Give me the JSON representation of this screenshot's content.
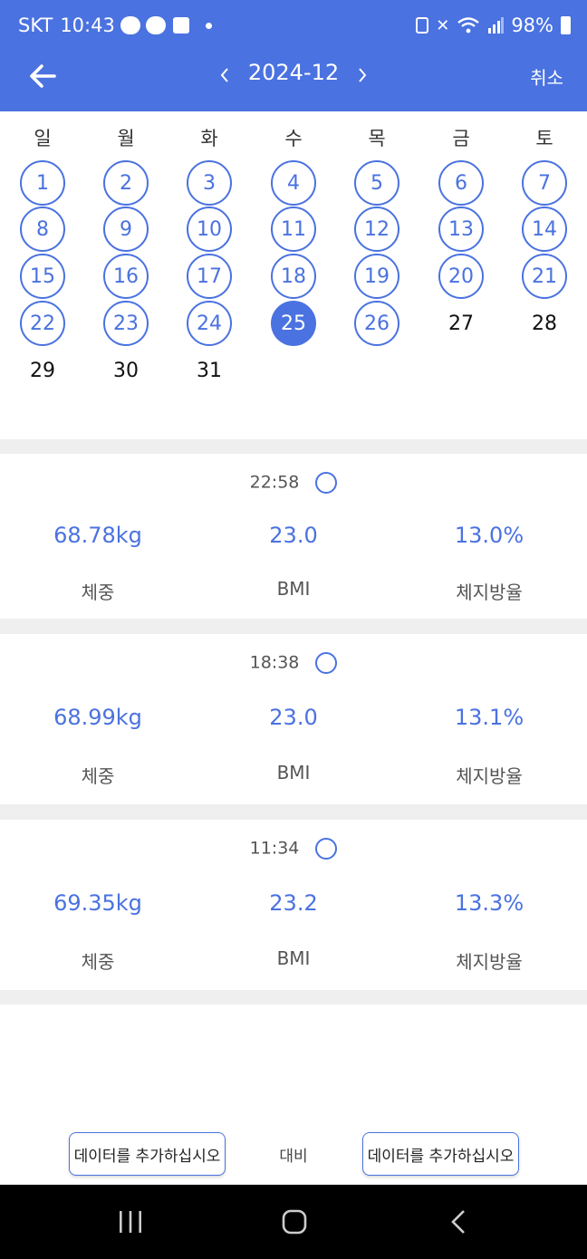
{
  "status_bar": {
    "carrier": "SKT",
    "time": "10:43",
    "battery": "98%"
  },
  "header": {
    "month": "2024-12",
    "cancel": "취소",
    "back_icon": "arrow-left-icon",
    "prev_icon": "chevron-left-icon",
    "next_icon": "chevron-right-icon"
  },
  "calendar": {
    "weekdays": [
      "일",
      "월",
      "화",
      "수",
      "목",
      "금",
      "토"
    ],
    "days": [
      {
        "d": "1",
        "s": "mark"
      },
      {
        "d": "2",
        "s": "mark"
      },
      {
        "d": "3",
        "s": "mark"
      },
      {
        "d": "4",
        "s": "mark"
      },
      {
        "d": "5",
        "s": "mark"
      },
      {
        "d": "6",
        "s": "mark"
      },
      {
        "d": "7",
        "s": "mark"
      },
      {
        "d": "8",
        "s": "mark"
      },
      {
        "d": "9",
        "s": "mark"
      },
      {
        "d": "10",
        "s": "mark"
      },
      {
        "d": "11",
        "s": "mark"
      },
      {
        "d": "12",
        "s": "mark"
      },
      {
        "d": "13",
        "s": "mark"
      },
      {
        "d": "14",
        "s": "mark"
      },
      {
        "d": "15",
        "s": "mark"
      },
      {
        "d": "16",
        "s": "mark"
      },
      {
        "d": "17",
        "s": "mark"
      },
      {
        "d": "18",
        "s": "mark"
      },
      {
        "d": "19",
        "s": "mark"
      },
      {
        "d": "20",
        "s": "mark"
      },
      {
        "d": "21",
        "s": "mark"
      },
      {
        "d": "22",
        "s": "mark"
      },
      {
        "d": "23",
        "s": "mark"
      },
      {
        "d": "24",
        "s": "mark"
      },
      {
        "d": "25",
        "s": "sel"
      },
      {
        "d": "26",
        "s": "mark"
      },
      {
        "d": "27",
        "s": "plain"
      },
      {
        "d": "28",
        "s": "plain"
      },
      {
        "d": "29",
        "s": "plain"
      },
      {
        "d": "30",
        "s": "plain"
      },
      {
        "d": "31",
        "s": "plain"
      }
    ]
  },
  "records": [
    {
      "time": "22:58",
      "weight": "68.78kg",
      "bmi": "23.0",
      "fat": "13.0%",
      "weight_label": "체중",
      "bmi_label": "BMI",
      "fat_label": "체지방율"
    },
    {
      "time": "18:38",
      "weight": "68.99kg",
      "bmi": "23.0",
      "fat": "13.1%",
      "weight_label": "체중",
      "bmi_label": "BMI",
      "fat_label": "체지방율"
    },
    {
      "time": "11:34",
      "weight": "69.35kg",
      "bmi": "23.2",
      "fat": "13.3%",
      "weight_label": "체중",
      "bmi_label": "BMI",
      "fat_label": "체지방율"
    }
  ],
  "bottom": {
    "left_button": "데이터를 추가하십시오",
    "vs_label": "대비",
    "right_button": "데이터를 추가하십시오"
  },
  "colors": {
    "accent": "#4a72e0"
  }
}
